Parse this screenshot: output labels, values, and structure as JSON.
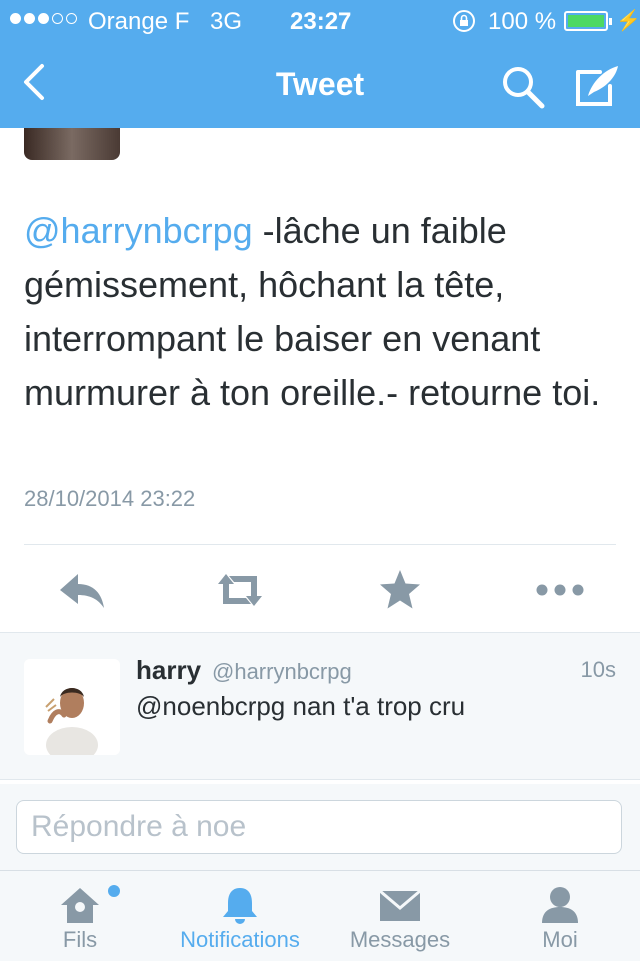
{
  "status_bar": {
    "carrier": "Orange F",
    "network": "3G",
    "time": "23:27",
    "battery": "100 %",
    "signal_bars_filled": 3,
    "signal_bars_total": 5
  },
  "nav": {
    "title": "Tweet",
    "icons": [
      "back-chevron-icon",
      "search-icon",
      "compose-icon"
    ]
  },
  "tweet": {
    "mention": "@harrynbcrpg",
    "body": " -lâche un faible gémissement, hôchant la tête, interrompant le baiser en venant murmurer à ton oreille.- retourne toi.",
    "date": "28/10/2014 23:22",
    "actions": [
      "reply-icon",
      "retweet-icon",
      "favorite-icon",
      "more-icon"
    ]
  },
  "reply": {
    "name": "harry",
    "handle": "@harrynbcrpg",
    "time": "10s",
    "text": "@noenbcrpg nan t'a trop cru"
  },
  "reply_box": {
    "placeholder": "Répondre à noe"
  },
  "tabs": [
    {
      "label": "Fils",
      "icon": "home-icon",
      "active": false,
      "has_dot": true
    },
    {
      "label": "Notifications",
      "icon": "bell-icon",
      "active": true
    },
    {
      "label": "Messages",
      "icon": "envelope-icon",
      "active": false
    },
    {
      "label": "Moi",
      "icon": "person-icon",
      "active": false
    }
  ],
  "colors": {
    "accent": "#55acee",
    "text": "#292f33",
    "muted": "#8899a6",
    "inactive_icon": "#8899a6",
    "battery": "#4cd964"
  }
}
